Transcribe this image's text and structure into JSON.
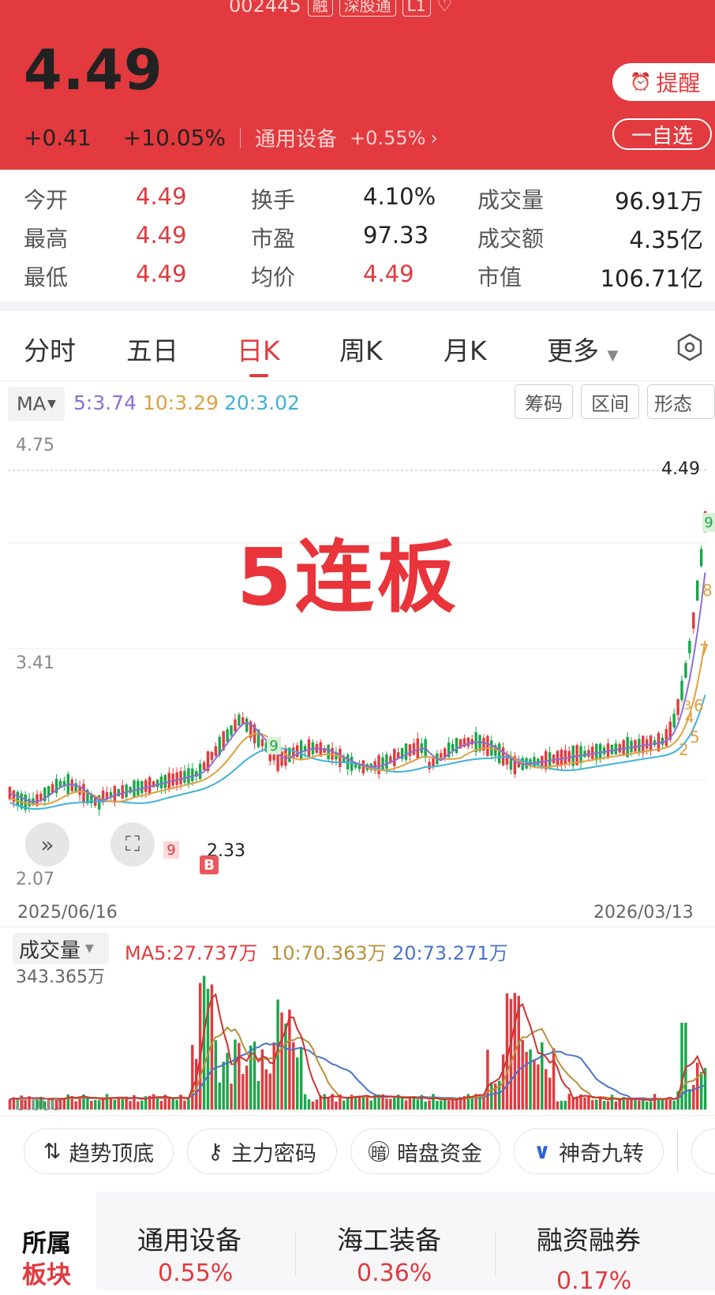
{
  "header": {
    "code": "002445",
    "tags": [
      "融",
      "深股通",
      "L1"
    ],
    "price": "4.49",
    "change": "+0.41",
    "change_pct": "+10.05%",
    "sector_name": "通用设备",
    "sector_pct": "+0.55%",
    "remind_label": "提醒",
    "fav_label": "一自选"
  },
  "stats": [
    {
      "label": "今开",
      "value": "4.49"
    },
    {
      "label": "换手",
      "value": "4.10%"
    },
    {
      "label": "成交量",
      "value": "96.91万"
    },
    {
      "label": "最高",
      "value": "4.49"
    },
    {
      "label": "市盈",
      "value": "97.33"
    },
    {
      "label": "成交额",
      "value": "4.35亿"
    },
    {
      "label": "最低",
      "value": "4.49"
    },
    {
      "label": "均价",
      "value": "4.49"
    },
    {
      "label": "市值",
      "value": "106.71亿"
    }
  ],
  "tabs": [
    "分时",
    "五日",
    "日K",
    "周K",
    "月K",
    "更多"
  ],
  "active_tab": "日K",
  "chart": {
    "ma_selector": "MA",
    "ma5": "5:3.74",
    "ma10": "10:3.29",
    "ma20": "20:3.02",
    "tools": [
      "筹码",
      "区间",
      "形态"
    ],
    "y_top": "4.75",
    "y_mid": "3.41",
    "y_bottom": "2.07",
    "last_price": "4.49",
    "low_mark": "2.33",
    "date_start": "2025/06/16",
    "date_end": "2026/03/13",
    "overlay_text": "5连板",
    "buy_badge": "B",
    "nine_marks": [
      "9",
      "9",
      "9",
      "8",
      "7",
      "6",
      "5",
      "4",
      "3",
      "2"
    ],
    "colors": {
      "up": "#e23a3e",
      "down": "#1aa64a",
      "ma5": "#8b6fd6",
      "ma10": "#e0a040",
      "ma20": "#3fb2d8"
    }
  },
  "volume": {
    "selector": "成交量",
    "ma5": "MA5:27.737万",
    "ma10": "10:70.363万",
    "ma20": "20:73.271万",
    "max_label": "343.365万",
    "zero_label": "0.000"
  },
  "tools_row": [
    "趋势顶底",
    "主力密码",
    "暗盘资金",
    "神奇九转"
  ],
  "sectors": {
    "title_top": "所属",
    "title_bottom": "板块",
    "items": [
      {
        "name": "通用设备",
        "pct": "0.55%"
      },
      {
        "name": "海工装备",
        "pct": "0.36%"
      },
      {
        "name": "融资融券",
        "pct": "0.17%"
      }
    ]
  }
}
